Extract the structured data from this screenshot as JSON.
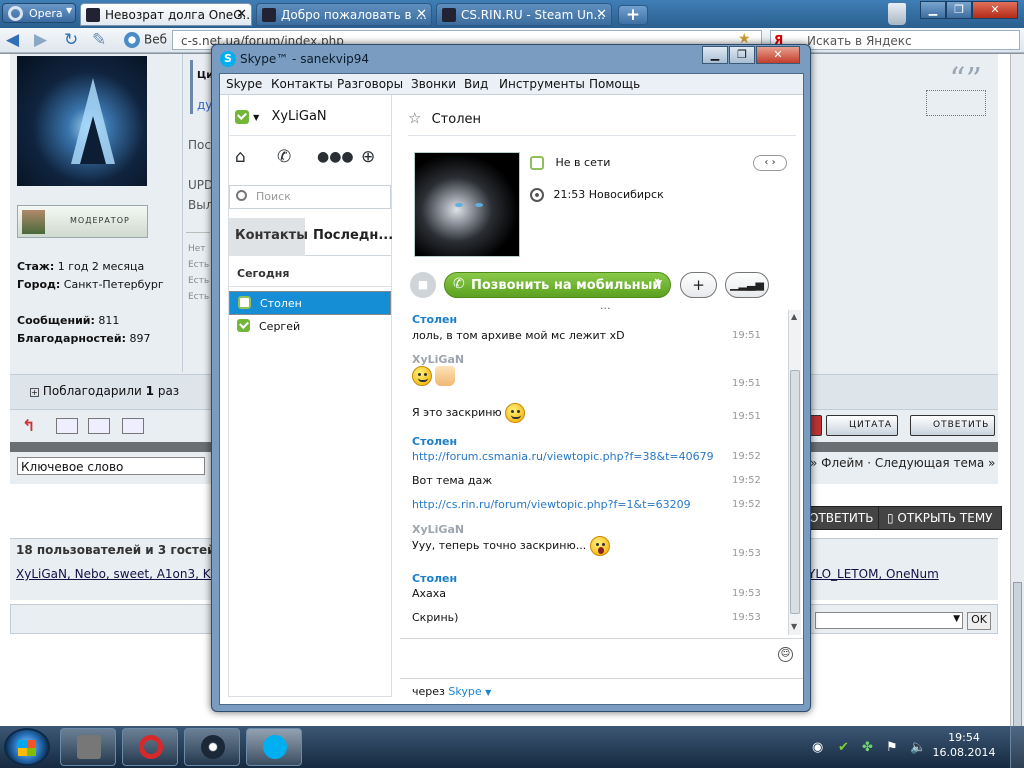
{
  "browser": {
    "menu_label": "Opera",
    "tabs": [
      {
        "title": "Невозрат долга OneG..."
      },
      {
        "title": "Добро пожаловать в ..."
      },
      {
        "title": "CS.RIN.RU - Steam Un..."
      }
    ],
    "new_tab": "+",
    "web_label": "Веб",
    "address": "c-s.net.ua/forum/index.php",
    "search_placeholder": "Искать в Яндекс",
    "search_engine_letter": "Я"
  },
  "forum": {
    "quote_label": "Ци",
    "quote_snippet": "ду",
    "moderator_badge": "МОДЕРАТОР",
    "stats": [
      {
        "label": "Стаж:",
        "value": " 1 год 2 месяца"
      },
      {
        "label": "Город:",
        "value": " Санкт-Петербург"
      },
      {
        "label": "Сообщений:",
        "value": " 811"
      },
      {
        "label": "Благодарностей:",
        "value": " 897"
      }
    ],
    "post_fragments": [
      "Пос",
      "UPD",
      "Выл"
    ],
    "small_fragments": [
      "Нет",
      "Есть",
      "Есть",
      "Есть"
    ],
    "thanked_label": "Поблагодарили",
    "thanked_count": "1",
    "thanked_suffix": "раз",
    "quote_button": "ЦИТАТА",
    "reply_button": "ОТВЕТИТЬ",
    "keyword_field": "Ключевое слово",
    "next_topic": "» Флейм · Следующая тема »",
    "big_reply": "ОТВЕТИТЬ",
    "open_topic": "ОТКРЫТЬ ТЕМУ",
    "users_header": "18 пользователей и 3 гостей чита",
    "users_list": "XyLiGaN, Nebo, sweet, A1on3, Kirby",
    "users_list_end": "YLO_LETOM, OneNum",
    "ok_button": "OK"
  },
  "skype": {
    "window_title": "Skype™ - sanekvip94",
    "menu": [
      "Skype",
      "Контакты",
      "Разговоры",
      "Звонки",
      "Вид",
      "Инструменты",
      "Помощь"
    ],
    "user_name": "XyLiGaN",
    "search_placeholder": "Поиск",
    "tab_contacts": "Контакты",
    "tab_recent": "Последн...",
    "today_label": "Сегодня",
    "contacts": [
      {
        "name": "Столен",
        "status": "offline",
        "selected": true
      },
      {
        "name": "Сергей",
        "status": "online",
        "selected": false
      }
    ],
    "chat": {
      "contact_name": "Столен",
      "status_text": "Не в сети",
      "local_time": "21:53 Новосибирск",
      "call_button": "Позвонить на мобильный",
      "ellipsis": "...",
      "messages": [
        {
          "sender": "Столен",
          "text": "лоль, в том архиве мой мс лежит xD",
          "time": "19:51"
        },
        {
          "sender": "XyLiGaN",
          "text": "",
          "emoticons": [
            "laughing",
            "thumbs-up"
          ],
          "time": "19:51"
        },
        {
          "text": "Я это заскриню",
          "emoticons": [
            "smile"
          ],
          "time": "19:51"
        },
        {
          "sender": "Столен",
          "link": "http://forum.csmania.ru/viewtopic.php?f=38&t=40679",
          "time": "19:52"
        },
        {
          "text": "Вот тема даж",
          "time": "19:52"
        },
        {
          "link": "http://cs.rin.ru/forum/viewtopic.php?f=1&t=63209",
          "time": "19:52"
        },
        {
          "sender": "XyLiGaN",
          "text": "Ууу, теперь точно заскриню...",
          "emoticons": [
            "surprised"
          ],
          "time": "19:53"
        },
        {
          "sender": "Столен",
          "text": "Ахаха",
          "time": "19:53"
        },
        {
          "text": "Скринь)",
          "time": "19:53"
        }
      ],
      "via_prefix": "через",
      "via_service": "Skype"
    }
  },
  "taskbar": {
    "time": "19:54",
    "date": "16.08.2014"
  },
  "colors": {
    "skype_blue": "#00aff0",
    "selection": "#168ed6",
    "call_green": "#5ba11f",
    "link": "#2878c6"
  }
}
